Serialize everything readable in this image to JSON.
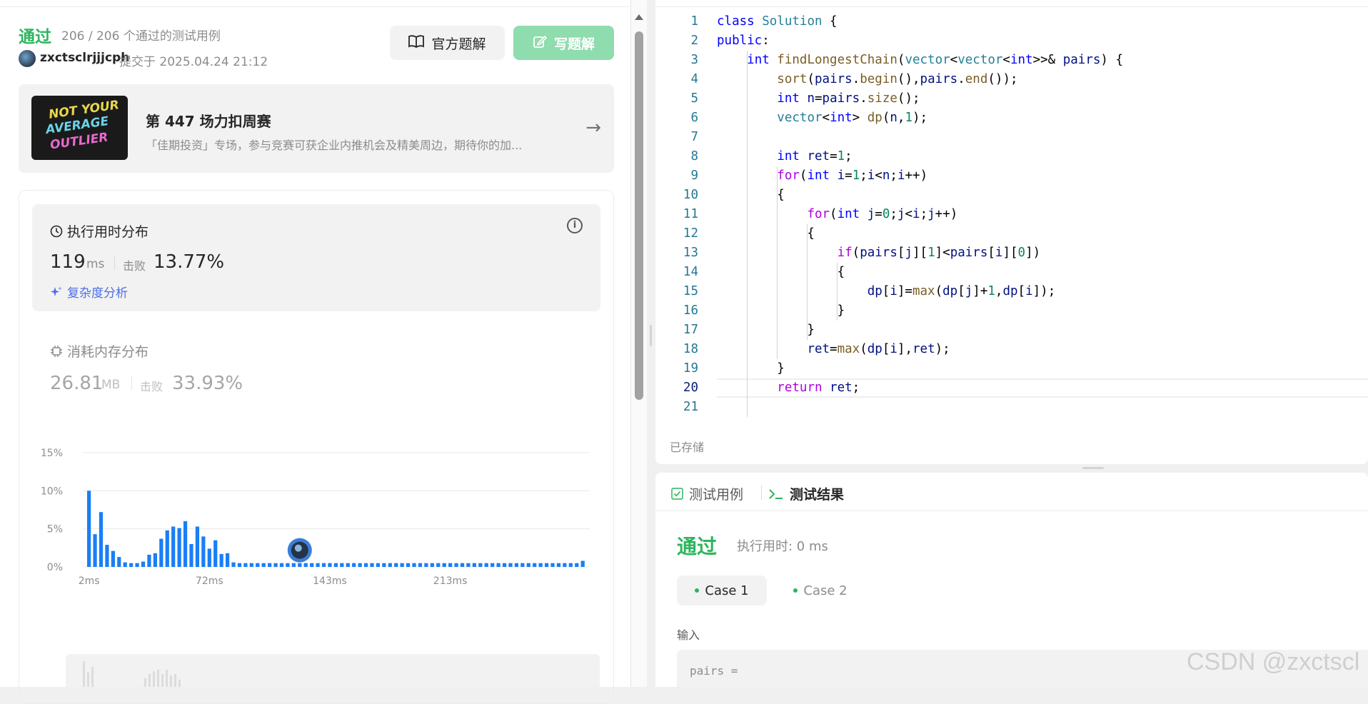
{
  "submission": {
    "status": "通过",
    "cases_text": "206 / 206 个通过的测试用例",
    "user": "zxctsclrjjjcph",
    "submitted_text": "提交于 2025.04.24 21:12",
    "official_solution_label": "官方题解",
    "write_solution_label": "写题解"
  },
  "banner": {
    "image_text": [
      "NOT YOUR",
      "AVERAGE",
      "OUTLIER"
    ],
    "title": "第 447 场力扣周赛",
    "description": "「佳期投资」专场，参与竞赛可获企业内推机会及精美周边，期待你的加..."
  },
  "runtime": {
    "title": "执行用时分布",
    "value": "119",
    "unit": "ms",
    "beat_label": "击败",
    "beat_value": "13.77%",
    "complexity_label": "复杂度分析"
  },
  "memory": {
    "title": "消耗内存分布",
    "value": "26.81",
    "unit": "MB",
    "beat_label": "击败",
    "beat_value": "33.93%"
  },
  "chart_data": {
    "type": "bar",
    "y_ticks": [
      "15%",
      "10%",
      "5%",
      "0%"
    ],
    "x_ticks": [
      "2ms",
      "72ms",
      "143ms",
      "213ms"
    ],
    "ylim": [
      0,
      15
    ],
    "bar_color": "#1a7ef7",
    "values": [
      10,
      4.3,
      7.2,
      2.9,
      2.1,
      1.3,
      0.6,
      0.5,
      0.5,
      0.7,
      1.6,
      1.8,
      3.7,
      4.8,
      5.3,
      5.1,
      6.0,
      3.0,
      5.3,
      4.0,
      2.4,
      3.5,
      1.7,
      1.8,
      0.6,
      0.5,
      0.5,
      0.5,
      0.5,
      0.5,
      0.5,
      0.5,
      0.5,
      0.5,
      0.5,
      0.5,
      0.5,
      0.5,
      0.5,
      0.5,
      0.5,
      0.5,
      0.5,
      0.5,
      0.5,
      0.5,
      0.5,
      0.5,
      0.5,
      0.5,
      0.5,
      0.5,
      0.5,
      0.5,
      0.5,
      0.5,
      0.5,
      0.5,
      0.5,
      0.5,
      0.5,
      0.5,
      0.5,
      0.5,
      0.5,
      0.5,
      0.5,
      0.5,
      0.5,
      0.5,
      0.5,
      0.5,
      0.5,
      0.5,
      0.5,
      0.5,
      0.5,
      0.5,
      0.5,
      0.5,
      0.5,
      0.5,
      0.8
    ],
    "marker_bar_index": 35
  },
  "editor": {
    "active_line": 20,
    "saved_label": "已存储",
    "lines": [
      [
        [
          "k",
          "class"
        ],
        [
          "",
          ""
        ],
        [
          "t",
          " Solution"
        ],
        [
          "",
          " {"
        ]
      ],
      [
        [
          "k",
          "public"
        ],
        [
          "",
          ":"
        ]
      ],
      [
        [
          "",
          "    "
        ],
        [
          "k",
          "int"
        ],
        [
          "f",
          " findLongestChain"
        ],
        [
          "",
          "("
        ],
        [
          "t",
          "vector"
        ],
        [
          "",
          "<"
        ],
        [
          "t",
          "vector"
        ],
        [
          "",
          "<"
        ],
        [
          "k",
          "int"
        ],
        [
          "",
          ">>& "
        ],
        [
          "v",
          "pairs"
        ],
        [
          "",
          ") {"
        ]
      ],
      [
        [
          "",
          "        "
        ],
        [
          "f",
          "sort"
        ],
        [
          "",
          "("
        ],
        [
          "v",
          "pairs"
        ],
        [
          "",
          "."
        ],
        [
          "f",
          "begin"
        ],
        [
          "",
          "(),"
        ],
        [
          "v",
          "pairs"
        ],
        [
          "",
          "."
        ],
        [
          "f",
          "end"
        ],
        [
          "",
          "());"
        ]
      ],
      [
        [
          "",
          "        "
        ],
        [
          "k",
          "int"
        ],
        [
          "v",
          " n"
        ],
        [
          "",
          "="
        ],
        [
          "v",
          "pairs"
        ],
        [
          "",
          "."
        ],
        [
          "f",
          "size"
        ],
        [
          "",
          "();"
        ]
      ],
      [
        [
          "",
          "        "
        ],
        [
          "t",
          "vector"
        ],
        [
          "",
          "<"
        ],
        [
          "k",
          "int"
        ],
        [
          "",
          "> "
        ],
        [
          "f",
          "dp"
        ],
        [
          "",
          "("
        ],
        [
          "v",
          "n"
        ],
        [
          "",
          ","
        ],
        [
          "n",
          "1"
        ],
        [
          "",
          ");"
        ]
      ],
      [],
      [
        [
          "",
          "        "
        ],
        [
          "k",
          "int"
        ],
        [
          "v",
          " ret"
        ],
        [
          "",
          "="
        ],
        [
          "n",
          "1"
        ],
        [
          "",
          ";"
        ]
      ],
      [
        [
          "",
          "        "
        ],
        [
          "c",
          "for"
        ],
        [
          "",
          "("
        ],
        [
          "k",
          "int"
        ],
        [
          "v",
          " i"
        ],
        [
          "",
          "="
        ],
        [
          "n",
          "1"
        ],
        [
          "",
          ";"
        ],
        [
          "v",
          "i"
        ],
        [
          "",
          "<"
        ],
        [
          "v",
          "n"
        ],
        [
          "",
          ";"
        ],
        [
          "v",
          "i"
        ],
        [
          "",
          "++)"
        ]
      ],
      [
        [
          "",
          "        {"
        ]
      ],
      [
        [
          "",
          "            "
        ],
        [
          "c",
          "for"
        ],
        [
          "",
          "("
        ],
        [
          "k",
          "int"
        ],
        [
          "v",
          " j"
        ],
        [
          "",
          "="
        ],
        [
          "n",
          "0"
        ],
        [
          "",
          ";"
        ],
        [
          "v",
          "j"
        ],
        [
          "",
          "<"
        ],
        [
          "v",
          "i"
        ],
        [
          "",
          ";"
        ],
        [
          "v",
          "j"
        ],
        [
          "",
          "++)"
        ]
      ],
      [
        [
          "",
          "            {"
        ]
      ],
      [
        [
          "",
          "                "
        ],
        [
          "c",
          "if"
        ],
        [
          "",
          "("
        ],
        [
          "v",
          "pairs"
        ],
        [
          "",
          "["
        ],
        [
          "v",
          "j"
        ],
        [
          "",
          "]["
        ],
        [
          "n",
          "1"
        ],
        [
          "",
          "]<"
        ],
        [
          "v",
          "pairs"
        ],
        [
          "",
          "["
        ],
        [
          "v",
          "i"
        ],
        [
          "",
          "]["
        ],
        [
          "n",
          "0"
        ],
        [
          "",
          "])"
        ]
      ],
      [
        [
          "",
          "                {"
        ]
      ],
      [
        [
          "",
          "                    "
        ],
        [
          "v",
          "dp"
        ],
        [
          "",
          "["
        ],
        [
          "v",
          "i"
        ],
        [
          "",
          "]="
        ],
        [
          "f",
          "max"
        ],
        [
          "",
          "("
        ],
        [
          "v",
          "dp"
        ],
        [
          "",
          "["
        ],
        [
          "v",
          "j"
        ],
        [
          "",
          "]+"
        ],
        [
          "n",
          "1"
        ],
        [
          "",
          ","
        ],
        [
          "v",
          "dp"
        ],
        [
          "",
          "["
        ],
        [
          "v",
          "i"
        ],
        [
          "",
          "]);"
        ]
      ],
      [
        [
          "",
          "                }"
        ]
      ],
      [
        [
          "",
          "            }"
        ]
      ],
      [
        [
          "",
          "            "
        ],
        [
          "v",
          "ret"
        ],
        [
          "",
          "="
        ],
        [
          "f",
          "max"
        ],
        [
          "",
          "("
        ],
        [
          "v",
          "dp"
        ],
        [
          "",
          "["
        ],
        [
          "v",
          "i"
        ],
        [
          "",
          "],"
        ],
        [
          "v",
          "ret"
        ],
        [
          "",
          ");"
        ]
      ],
      [
        [
          "",
          "        }"
        ]
      ],
      [
        [
          "",
          "        "
        ],
        [
          "c",
          "return"
        ],
        [
          "v",
          " ret"
        ],
        [
          "",
          ";"
        ]
      ],
      []
    ]
  },
  "result": {
    "tab_testcase": "测试用例",
    "tab_result": "测试结果",
    "status": "通过",
    "time_text": "执行用时: 0 ms",
    "case1": "Case 1",
    "case2": "Case 2",
    "input_label": "输入",
    "input_text": "pairs ="
  },
  "watermark": "CSDN @zxctscl",
  "colors": {
    "accent_green": "#2db55d",
    "link_blue": "#4c6fe8",
    "bar_blue": "#1a7ef7"
  }
}
